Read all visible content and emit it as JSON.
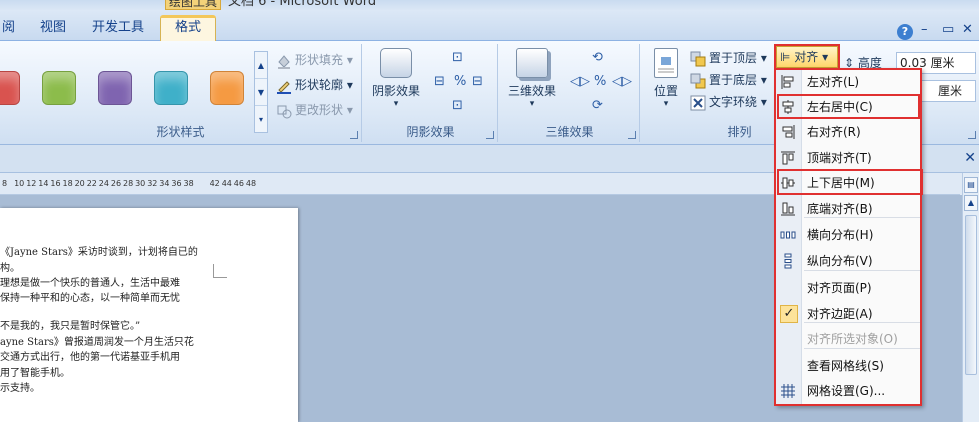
{
  "window": {
    "context_tab": "绘图工具",
    "doc_title": "文档 6 - Microsoft Word"
  },
  "tabs": [
    {
      "label": "阅"
    },
    {
      "label": "视图"
    },
    {
      "label": "开发工具"
    },
    {
      "label": "格式"
    }
  ],
  "window_controls": {
    "help": "?",
    "minimize": "–",
    "restore": "▭",
    "close": "✕"
  },
  "ribbon": {
    "shape_styles": {
      "label": "形状样式",
      "swatches": [
        "#d9534f",
        "#8cbc4b",
        "#7f64b0",
        "#3fb0c9",
        "#f59a42"
      ],
      "fill": "形状填充",
      "outline": "形状轮廓",
      "change": "更改形状"
    },
    "shadow": {
      "label": "阴影效果",
      "button": "阴影效果"
    },
    "three_d": {
      "label": "三维效果",
      "button": "三维效果"
    },
    "arrange": {
      "label": "排列",
      "position": "位置",
      "bring_front": "置于顶层",
      "send_back": "置于底层",
      "text_wrap": "文字环绕",
      "align": "对齐"
    },
    "size": {
      "height_label": "高度",
      "height_value": "0.03",
      "unit1": "厘米",
      "unit2": "厘米"
    }
  },
  "ruler_ticks": [
    "8",
    "10",
    "12",
    "14",
    "16",
    "18",
    "20",
    "22",
    "24",
    "26",
    "28",
    "30",
    "32",
    "34",
    "36",
    "38",
    "42",
    "44",
    "46",
    "48"
  ],
  "document": {
    "lines": [
      "《Jayne Stars》采访时谈到，计划将自已的",
      "构。",
      "理想是做一个快乐的普通人，生活中最难",
      "保持一种平和的心态，以一种简单而无忧",
      "",
      "不是我的，我只是暂时保管它。”",
      "ayne Stars》曾报道周润发一个月生活只花",
      "交通方式出行，他的第一代诺基亚手机用",
      "用了智能手机。",
      "示支持。"
    ]
  },
  "align_menu": {
    "items": [
      {
        "label": "左对齐(L)",
        "icon": "align-left-icon",
        "disabled": false,
        "checked": false
      },
      {
        "label": "左右居中(C)",
        "icon": "align-center-icon",
        "disabled": false,
        "checked": false
      },
      {
        "label": "右对齐(R)",
        "icon": "align-right-icon",
        "disabled": false,
        "checked": false
      },
      {
        "label": "顶端对齐(T)",
        "icon": "align-top-icon",
        "disabled": false,
        "checked": false
      },
      {
        "label": "上下居中(M)",
        "icon": "align-middle-icon",
        "disabled": false,
        "checked": false
      },
      {
        "label": "底端对齐(B)",
        "icon": "align-bottom-icon",
        "disabled": false,
        "checked": false
      },
      {
        "label": "横向分布(H)",
        "icon": "distribute-horizontal-icon",
        "disabled": false,
        "checked": false
      },
      {
        "label": "纵向分布(V)",
        "icon": "distribute-vertical-icon",
        "disabled": false,
        "checked": false
      },
      {
        "label": "对齐页面(P)",
        "icon": "",
        "disabled": false,
        "checked": false
      },
      {
        "label": "对齐边距(A)",
        "icon": "checkmark-icon",
        "disabled": false,
        "checked": true
      },
      {
        "label": "对齐所选对象(O)",
        "icon": "",
        "disabled": true,
        "checked": false
      },
      {
        "label": "查看网格线(S)",
        "icon": "",
        "disabled": false,
        "checked": false
      },
      {
        "label": "网格设置(G)...",
        "icon": "grid-icon",
        "disabled": false,
        "checked": false
      }
    ]
  },
  "colors": {
    "highlight_red": "#e03030",
    "active_tab": "#fdf6e0"
  }
}
